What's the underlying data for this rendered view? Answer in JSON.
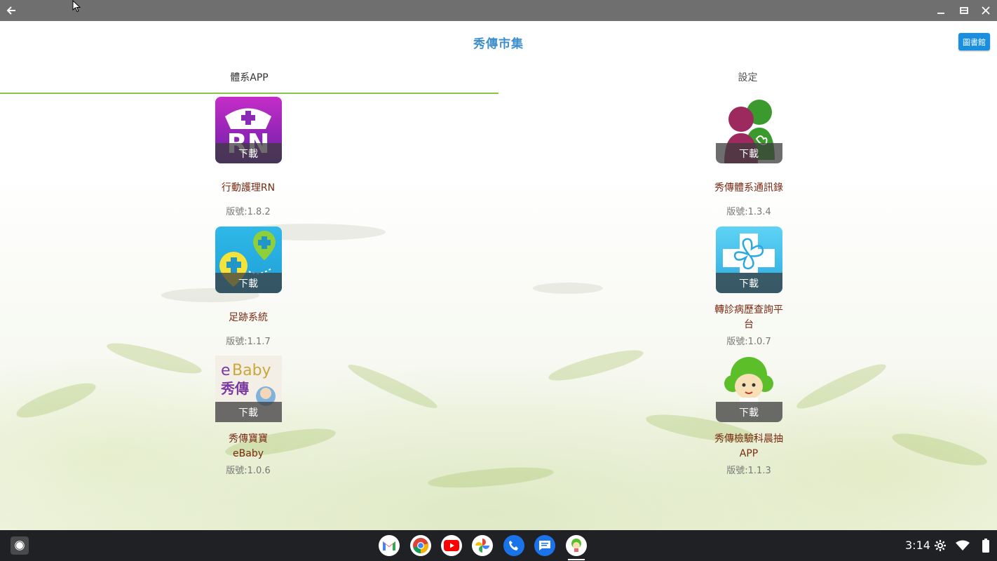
{
  "window": {
    "back_icon": "arrow-left-icon",
    "minimize_icon": "minimize-icon",
    "maximize_icon": "maximize-icon",
    "close_icon": "close-icon"
  },
  "header": {
    "title": "秀傳市集",
    "library_button": "圖書館"
  },
  "tabs": [
    {
      "label": "體系APP",
      "selected": true
    },
    {
      "label": "設定",
      "selected": false
    }
  ],
  "accent_color": "#8cc34a",
  "title_color": "#3f8fcc",
  "apps_left": [
    {
      "name": "行動護理RN",
      "version": "版號:1.8.2",
      "download": "下載",
      "icon": "rn-nurse-icon"
    },
    {
      "name": "足跡系統",
      "version": "版號:1.1.7",
      "download": "下載",
      "icon": "footprint-map-pin-icon"
    },
    {
      "name": "秀傳寶寶\neBaby",
      "version": "版號:1.0.6",
      "download": "下載",
      "icon": "ebaby-icon"
    }
  ],
  "apps_right": [
    {
      "name": "秀傳體系通訊錄",
      "version": "版號:1.3.4",
      "download": "下載",
      "icon": "contacts-people-icon"
    },
    {
      "name": "轉診病歷查詢平台",
      "version": "版號:1.0.7",
      "download": "下載",
      "icon": "clover-cross-icon"
    },
    {
      "name": "秀傳檢驗科晨抽APP",
      "version": "版號:1.1.3",
      "download": "下載",
      "icon": "mascot-icon"
    }
  ],
  "shelf": {
    "apps": [
      "gmail-icon",
      "chrome-icon",
      "youtube-icon",
      "photos-icon",
      "phone-icon",
      "messages-icon",
      "show-chwan-market-icon"
    ],
    "time": "3:14"
  }
}
